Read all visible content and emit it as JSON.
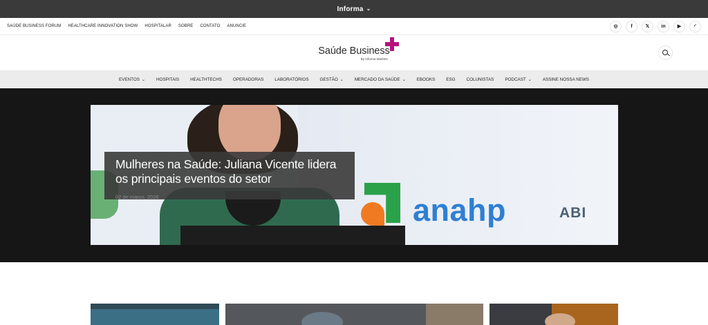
{
  "informa_bar": {
    "label": "Informa",
    "chevron_icon": "chevron-down-icon"
  },
  "top_links": [
    "SAÚDE BUSINESS FORUM",
    "HEALTHCARE INNOVATION SHOW",
    "HOSPITALAR",
    "SOBRE",
    "CONTATO",
    "ANUNCIE"
  ],
  "socials": [
    {
      "icon": "instagram-icon",
      "glyph": "◎"
    },
    {
      "icon": "facebook-icon",
      "glyph": "f"
    },
    {
      "icon": "x-icon",
      "glyph": "𝕏"
    },
    {
      "icon": "linkedin-icon",
      "glyph": "in"
    },
    {
      "icon": "youtube-icon",
      "glyph": "▶"
    },
    {
      "icon": "rss-icon",
      "glyph": "◜"
    }
  ],
  "logo": {
    "name": "Saúde Business",
    "tagline": "By Informa Markets",
    "accent_color": "#b5127b"
  },
  "main_nav": [
    {
      "label": "EVENTOS",
      "dropdown": true
    },
    {
      "label": "HOSPITAIS",
      "dropdown": false
    },
    {
      "label": "HEALTHTECHS",
      "dropdown": false
    },
    {
      "label": "OPERADORAS",
      "dropdown": false
    },
    {
      "label": "LABORATÓRIOS",
      "dropdown": false
    },
    {
      "label": "GESTÃO",
      "dropdown": true
    },
    {
      "label": "MERCADO DA SAÚDE",
      "dropdown": true
    },
    {
      "label": "EBOOKS",
      "dropdown": false
    },
    {
      "label": "ESG",
      "dropdown": false
    },
    {
      "label": "COLUNISTAS",
      "dropdown": false
    },
    {
      "label": "PODCAST",
      "dropdown": true
    },
    {
      "label": "ASSINE NOSSA NEWS",
      "dropdown": false
    }
  ],
  "hero": {
    "title": "Mulheres na Saúde: Juliana Vicente lidera os principais eventos do setor",
    "date": "02 de março, 2026",
    "banner_text": "anahp",
    "banner_text_2": "ABI"
  }
}
